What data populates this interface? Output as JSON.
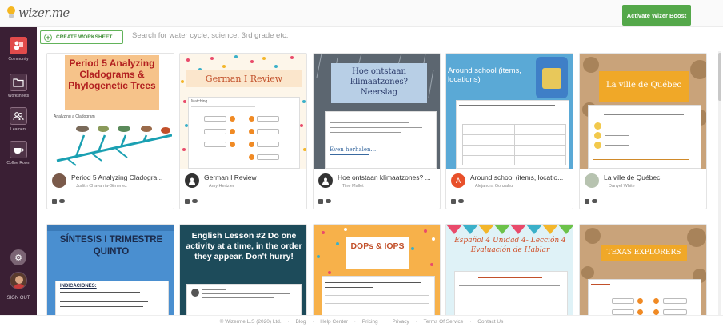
{
  "app": {
    "logo_text": "wizer.me"
  },
  "header": {
    "boost_label": "Activate Wizer Boost"
  },
  "sidebar": {
    "items": [
      {
        "label": "Community"
      },
      {
        "label": "Worksheets"
      },
      {
        "label": "Learners"
      },
      {
        "label": "Coffee Room"
      }
    ],
    "sign_out": "SIGN OUT"
  },
  "toolbar": {
    "create_label": "CREATE WORKSHEET",
    "search_placeholder": "Search for water cycle, science, 3rd grade etc."
  },
  "cards": [
    {
      "title": "Period 5 Analyzing Cladogra...",
      "author": "Judith Chavarria-Gimenez",
      "thumb_title": "Period 5 Analyzing Cladograms & Phylogenetic Trees",
      "thumb_caption": "Analyzing a Cladogram"
    },
    {
      "title": "German I Review",
      "author": "Amy Hertzler",
      "thumb_title": "German I Review",
      "thumb_caption": "Matching"
    },
    {
      "title": "Hoe ontstaan klimaatzones? ...",
      "author": "Tine Mallet",
      "thumb_title": "Hoe ontstaan klimaatzones? Neerslag",
      "thumb_caption": "Even herhalen..."
    },
    {
      "title": "Around school (items, locatio...",
      "author": "Alejandra Gonzalez",
      "avatar_letter": "A",
      "thumb_title": "Around school (items, locations)"
    },
    {
      "title": "La ville de Québec",
      "author": "Danyel White",
      "thumb_title": "La ville de Québec"
    },
    {
      "thumb_title": "SÍNTESIS I TRIMESTRE QUINTO",
      "thumb_caption": "INDICACIONES:"
    },
    {
      "thumb_title": "English Lesson #2 Do one activity at a time, in the order they appear. Don't hurry!"
    },
    {
      "thumb_title": "DOPs & IOPS"
    },
    {
      "thumb_title": "Español 4 Unidad 4- Lección 4 Evaluación de Hablar"
    },
    {
      "thumb_title": "TEXAS EXPLORERS"
    }
  ],
  "footer": {
    "copyright": "© Wizerme L.S (2020) Ltd.",
    "links": [
      "Blog",
      "Help Center",
      "Pricing",
      "Privacy",
      "Terms Of Service",
      "Contact Us"
    ]
  },
  "colors": {
    "sidebar_bg": "#3a1f34",
    "accent_green": "#54a84a",
    "active_red": "#e14b4b"
  }
}
